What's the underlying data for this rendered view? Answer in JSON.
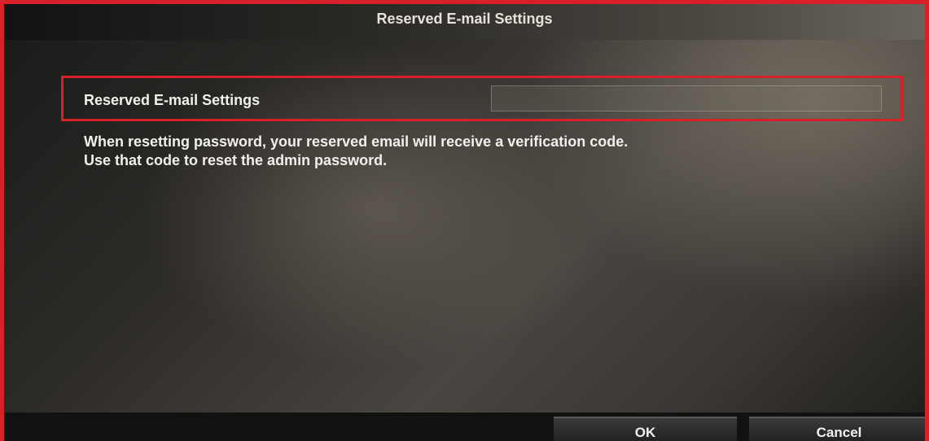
{
  "dialog": {
    "title": "Reserved E-mail Settings"
  },
  "setting": {
    "label": "Reserved E-mail Settings",
    "email_value": ""
  },
  "info": {
    "line1": "When resetting password, your reserved email will receive a verification code.",
    "line2": "Use that code to reset the admin password."
  },
  "buttons": {
    "ok": "OK",
    "cancel": "Cancel"
  },
  "colors": {
    "highlight_border": "#d8202a"
  }
}
